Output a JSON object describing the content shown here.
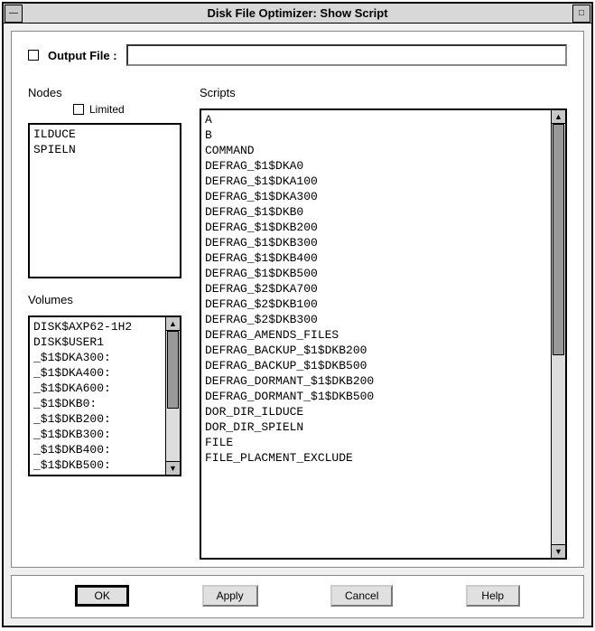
{
  "window": {
    "title": "Disk File Optimizer: Show Script"
  },
  "output": {
    "checkbox_label": "Output File :",
    "value": ""
  },
  "nodes": {
    "label": "Nodes",
    "limited_label": "Limited",
    "items": [
      "ILDUCE",
      "SPIELN"
    ]
  },
  "volumes": {
    "label": "Volumes",
    "items": [
      "DISK$AXP62-1H2",
      "DISK$USER1",
      "_$1$DKA300:",
      "_$1$DKA400:",
      "_$1$DKA600:",
      "_$1$DKB0:",
      "_$1$DKB200:",
      "_$1$DKB300:",
      "_$1$DKB400:",
      "_$1$DKB500:"
    ]
  },
  "scripts": {
    "label": "Scripts",
    "items": [
      "A",
      "B",
      "COMMAND",
      "DEFRAG_$1$DKA0",
      "DEFRAG_$1$DKA100",
      "DEFRAG_$1$DKA300",
      "DEFRAG_$1$DKB0",
      "DEFRAG_$1$DKB200",
      "DEFRAG_$1$DKB300",
      "DEFRAG_$1$DKB400",
      "DEFRAG_$1$DKB500",
      "DEFRAG_$2$DKA700",
      "DEFRAG_$2$DKB100",
      "DEFRAG_$2$DKB300",
      "DEFRAG_AMENDS_FILES",
      "DEFRAG_BACKUP_$1$DKB200",
      "DEFRAG_BACKUP_$1$DKB500",
      "DEFRAG_DORMANT_$1$DKB200",
      "DEFRAG_DORMANT_$1$DKB500",
      "DOR_DIR_ILDUCE",
      "DOR_DIR_SPIELN",
      "FILE",
      "FILE_PLACMENT_EXCLUDE"
    ]
  },
  "buttons": {
    "ok": "OK",
    "apply": "Apply",
    "cancel": "Cancel",
    "help": "Help"
  }
}
